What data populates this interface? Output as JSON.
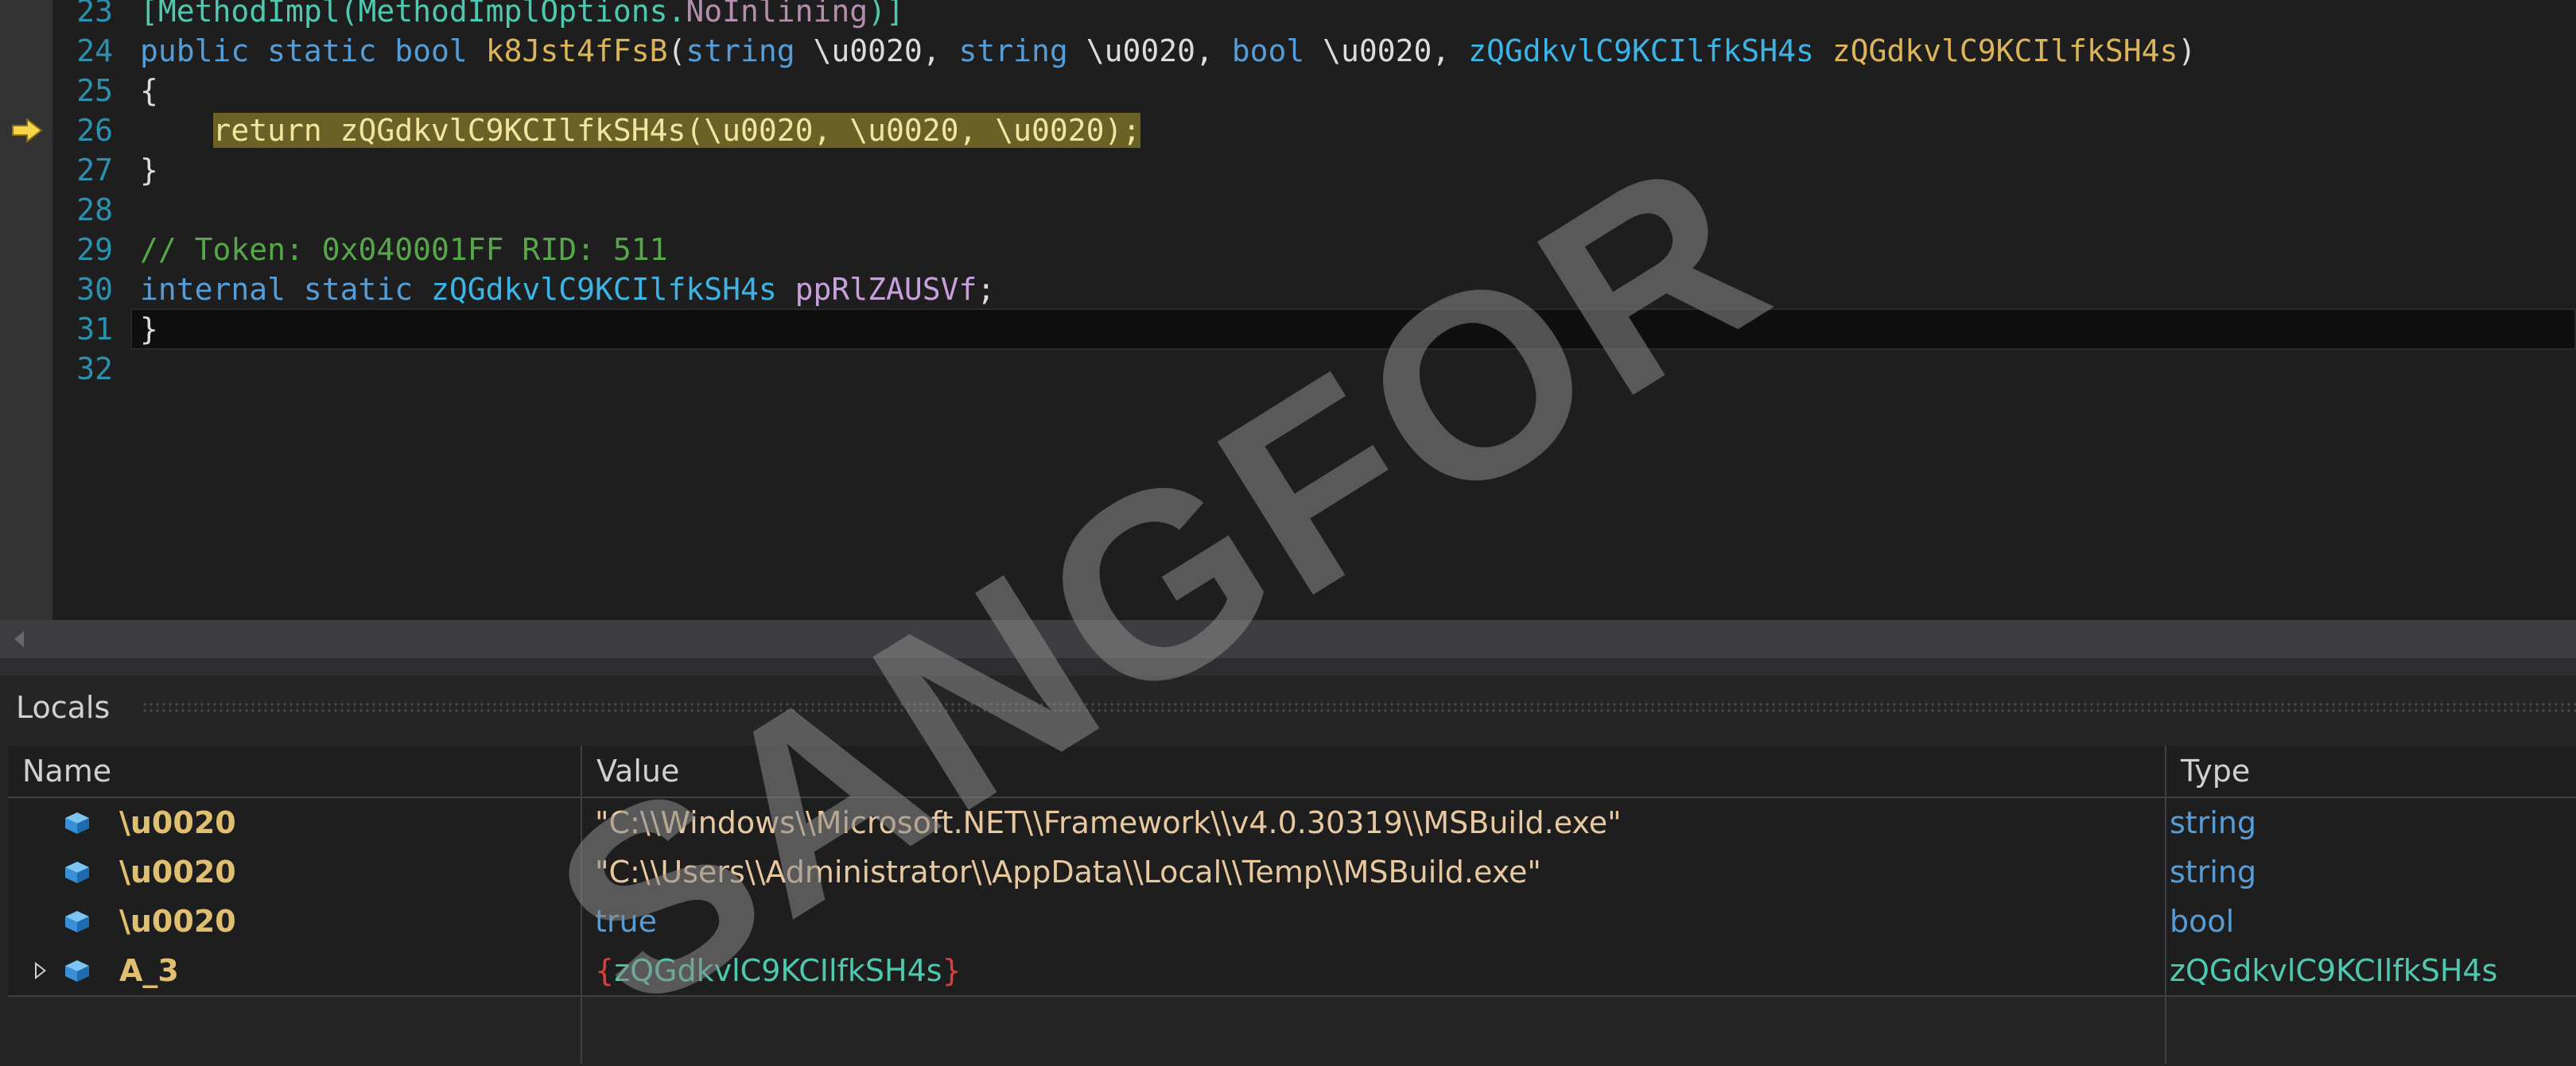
{
  "editor": {
    "lines": [
      {
        "num": "23",
        "tokens": [
          [
            "attr",
            "[MethodImpl(MethodImplOptions."
          ],
          [
            "purple",
            "NoInlining"
          ],
          [
            "attr",
            ")]"
          ]
        ]
      },
      {
        "num": "24",
        "tokens": [
          [
            "kw",
            "public static bool "
          ],
          [
            "mth",
            "k8Jst4fFsB"
          ],
          [
            "id",
            "("
          ],
          [
            "kw",
            "string "
          ],
          [
            "id",
            "\\u0020, "
          ],
          [
            "kw",
            "string "
          ],
          [
            "id",
            "\\u0020, "
          ],
          [
            "kw",
            "bool "
          ],
          [
            "id",
            "\\u0020, "
          ],
          [
            "ty2",
            "zQGdkvlC9KCIlfkSH4s "
          ],
          [
            "mth",
            "zQGdkvlC9KCIlfkSH4s"
          ],
          [
            "id",
            ")"
          ]
        ]
      },
      {
        "num": "25",
        "tokens": [
          [
            "id",
            "{"
          ]
        ]
      },
      {
        "num": "26",
        "tokens": [
          [
            "id",
            "    "
          ],
          [
            "hl",
            "return zQGdkvlC9KCIlfkSH4s(\\u0020, \\u0020, \\u0020);"
          ]
        ]
      },
      {
        "num": "27",
        "tokens": [
          [
            "id",
            "}"
          ]
        ]
      },
      {
        "num": "28",
        "tokens": []
      },
      {
        "num": "29",
        "tokens": [
          [
            "cm",
            "// Token: 0x040001FF RID: 511"
          ]
        ]
      },
      {
        "num": "30",
        "tokens": [
          [
            "kw",
            "internal static "
          ],
          [
            "ty2",
            "zQGdkvlC9KCIlfkSH4s "
          ],
          [
            "fld",
            "ppRlZAUSVf"
          ],
          [
            "id",
            ";"
          ]
        ]
      },
      {
        "num": "31",
        "tokens": [
          [
            "id",
            "}"
          ]
        ]
      },
      {
        "num": "32",
        "tokens": []
      }
    ],
    "current_line": "26",
    "caret_line": "31"
  },
  "locals": {
    "title": "Locals",
    "columns": {
      "name": "Name",
      "value": "Value",
      "type": "Type"
    },
    "rows": [
      {
        "name": "\\u0020",
        "value": "\"C:\\\\Windows\\\\Microsoft.NET\\\\Framework\\\\v4.0.30319\\\\MSBuild.exe\"",
        "type": "string",
        "kind": "str",
        "expandable": false
      },
      {
        "name": "\\u0020",
        "value": "\"C:\\\\Users\\\\Administrator\\\\AppData\\\\Local\\\\Temp\\\\MSBuild.exe\"",
        "type": "string",
        "kind": "str",
        "expandable": false
      },
      {
        "name": "\\u0020",
        "value": "true",
        "type": "bool",
        "kind": "bool",
        "expandable": false
      },
      {
        "name": "A_3",
        "value": "zQGdkvlC9KCIlfkSH4s",
        "value_open": "{",
        "value_close": "}",
        "type": "zQGdkvlC9KCIlfkSH4s",
        "kind": "obj",
        "expandable": true
      }
    ]
  },
  "watermark": {
    "text": "SANGFOR"
  },
  "icons": {
    "execution_pointer": "execution-arrow-icon",
    "local_variable": "local-variable-icon",
    "expand": "expand-arrow-icon"
  },
  "colors": {
    "editor_bg": "#1e1e1e",
    "line_number": "#2b91af",
    "keyword": "#569cd6",
    "type": "#4ec9b0",
    "method": "#dcb45a",
    "comment": "#57a64a",
    "highlight": "#6b6127",
    "exec_arrow": "#f5d547"
  }
}
